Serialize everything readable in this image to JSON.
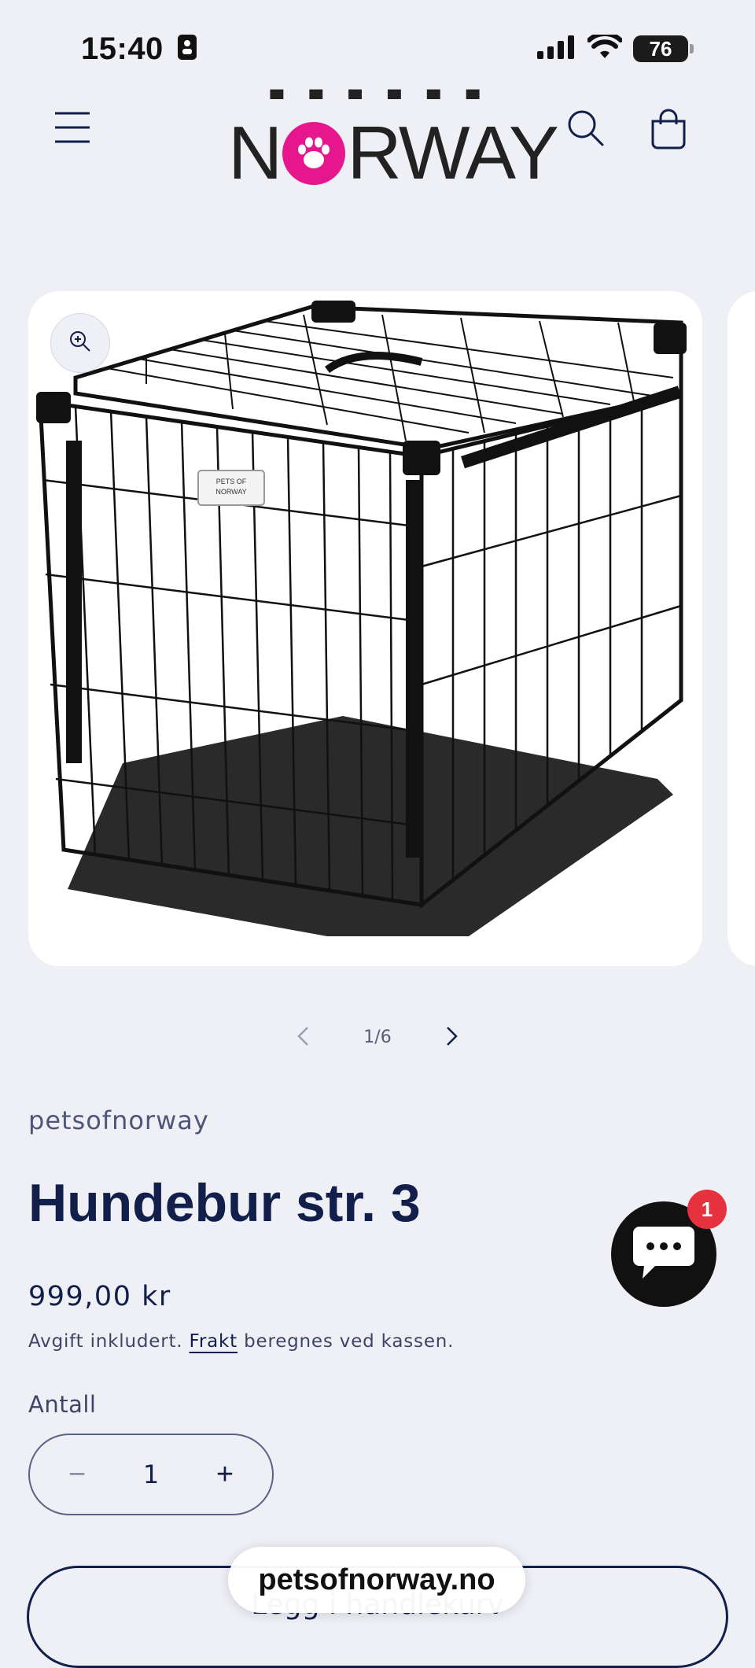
{
  "status_bar": {
    "time": "15:40",
    "battery": "76"
  },
  "header": {
    "logo_part1": "N",
    "logo_part2": "RWAY",
    "logo_icon": "paw-icon"
  },
  "gallery": {
    "counter": "1/6",
    "icons": [
      "zoom-icon",
      "chevron-left-icon",
      "chevron-right-icon"
    ]
  },
  "product": {
    "vendor": "petsofnorway",
    "title": "Hundebur str. 3",
    "price": "999,00 kr",
    "tax_before": "Avgift inkludert.",
    "tax_link": "Frakt",
    "tax_after": "beregnes ved kassen.",
    "cage_label": "PETS OF NORWAY"
  },
  "quantity": {
    "label": "Antall",
    "value": "1",
    "minus": "−",
    "plus": "+"
  },
  "cart_button": {
    "label": "Legg i handlekurv"
  },
  "chat": {
    "badge": "1"
  },
  "browser": {
    "url": "petsofnorway.no"
  },
  "colors": {
    "brand_pink": "#e6178c",
    "navy": "#121f4b",
    "background": "#eef0f6",
    "badge_red": "#e6323e"
  }
}
